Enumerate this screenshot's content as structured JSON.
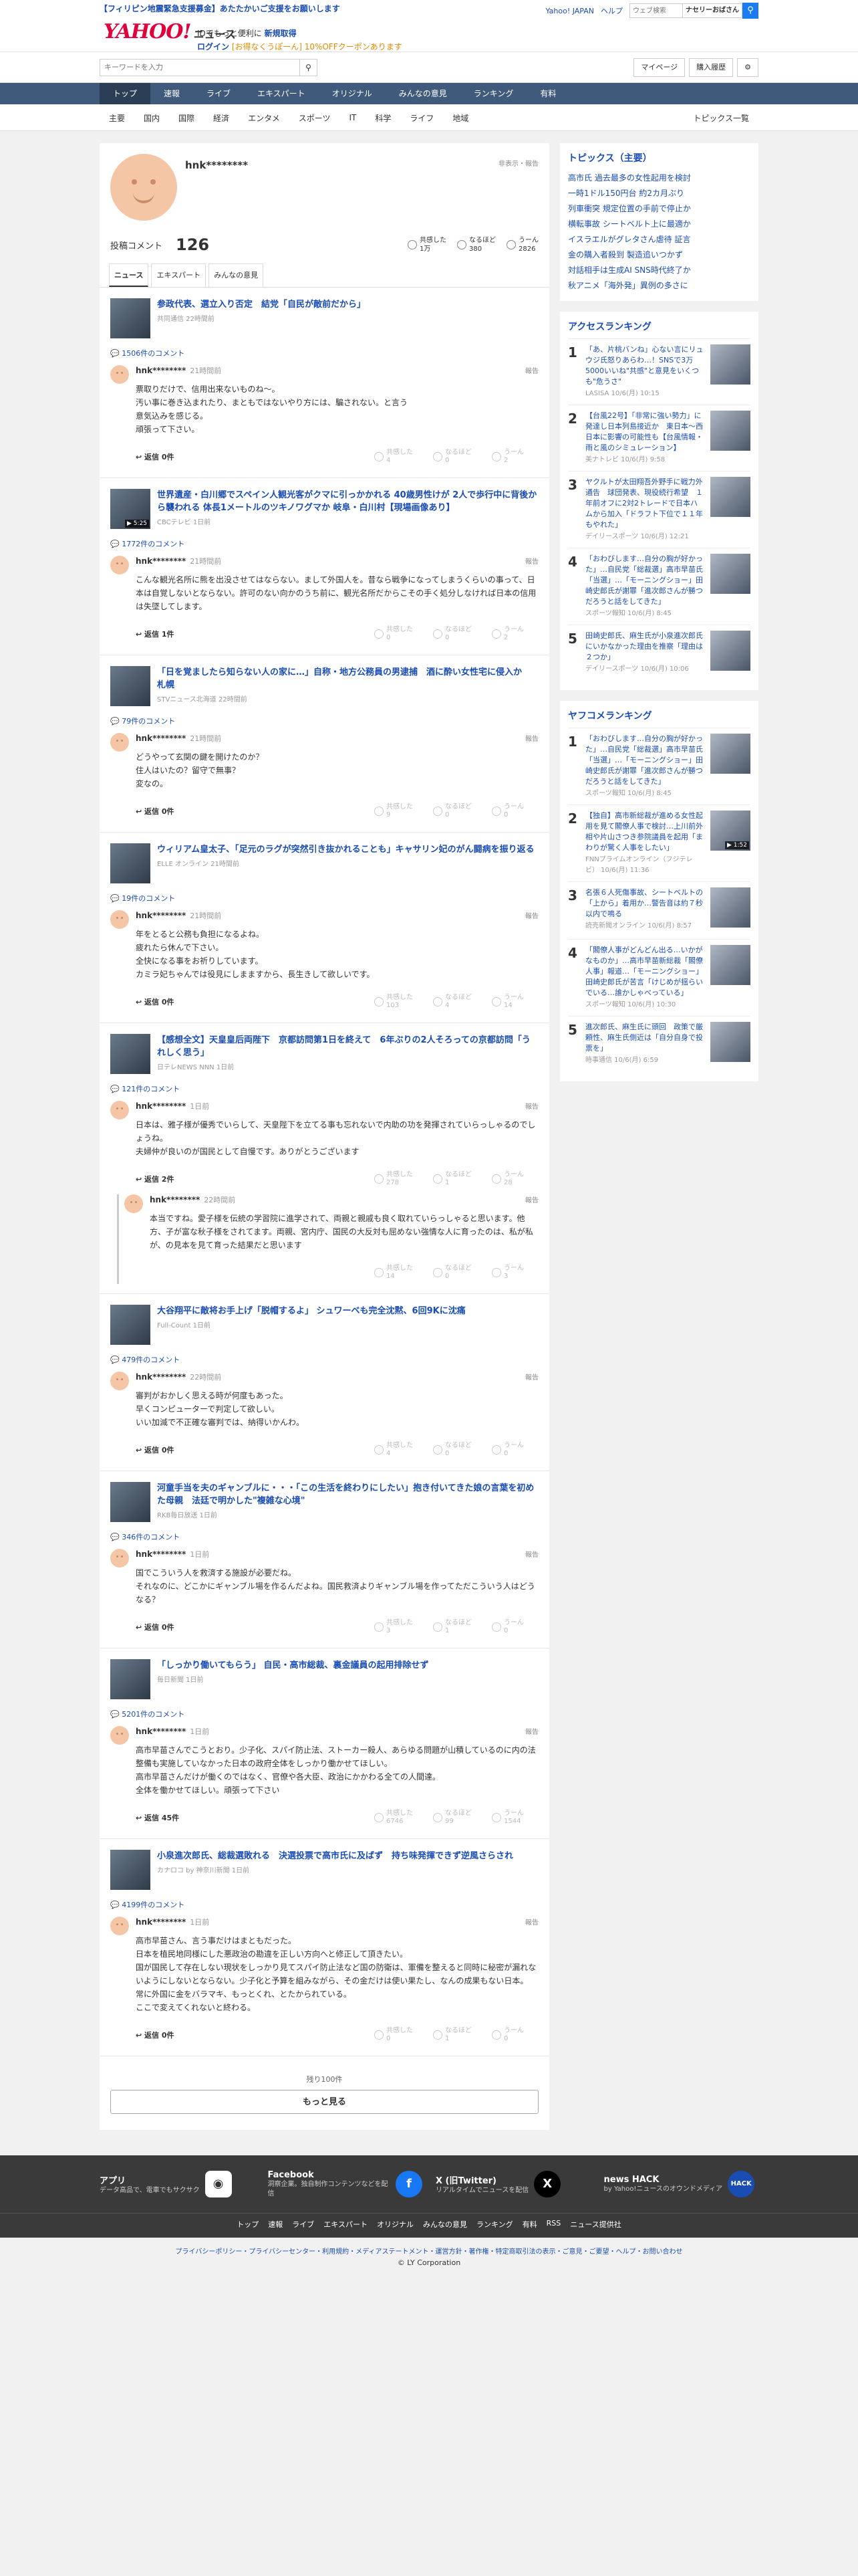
{
  "header": {
    "alert": "【フィリピン地震緊急支援募金】あたたかいご支援をお願いします",
    "links": [
      "Yahoo! JAPAN",
      "ヘルプ"
    ],
    "search_placeholder": "ウェブ検索",
    "user": "ナセリーおばさん",
    "logo_main": "YAHOO!",
    "logo_sub": "JAPAN",
    "logo_news": "ニュース",
    "promo1": "IDでもっと便利に",
    "promo1_link": "新規取得",
    "promo2": "ログイン",
    "promo2_link": "[お得なくうぽーん] 10%OFFクーポンあります"
  },
  "subbar": {
    "keyword_placeholder": "キーワードを入力",
    "mypage": "マイページ",
    "history": "購入履歴"
  },
  "gnav": [
    "トップ",
    "速報",
    "ライブ",
    "エキスパート",
    "オリジナル",
    "みんなの意見",
    "ランキング",
    "有料"
  ],
  "cnav": [
    "主要",
    "国内",
    "国際",
    "経済",
    "エンタメ",
    "スポーツ",
    "IT",
    "科学",
    "ライフ",
    "地域"
  ],
  "cnav_list": "トピックス一覧",
  "profile": {
    "name": "hnk********",
    "public": "非表示・報告",
    "comment_label": "投稿コメント",
    "comment_count": "126",
    "reactions": [
      {
        "label": "共感した",
        "value": "1万"
      },
      {
        "label": "なるほど",
        "value": "380"
      },
      {
        "label": "うーん",
        "value": "2826"
      }
    ]
  },
  "tabs": [
    "ニュース",
    "エキスパート",
    "みんなの意見"
  ],
  "items": [
    {
      "title": "参政代表、選立入り否定　結党「自民が敵前だから」",
      "source": "共同通信 22時間前",
      "count": "1506件のコメント",
      "comments": [
        {
          "user": "hnk********",
          "time": "21時間前",
          "text": "票取りだけで、信用出来ないものね～。\n汚い事に巻き込まれたり、まともではないやり方には、騙されない。と言う\n意気込みを感じる。\n頑張って下さい。",
          "reply": "返信 0件",
          "r": [
            "4",
            "0",
            "2"
          ]
        }
      ]
    },
    {
      "title": "世界遺産・白川郷でスペイン人観光客がクマに引っかかれる 40歳男性けが 2人で歩行中に背後から襲われる 体長1メートルのツキノワグマか 岐阜・白川村【現場画像あり】",
      "source": "CBCテレビ 1日前",
      "count": "1772件のコメント",
      "video": "▶ 5:25",
      "comments": [
        {
          "user": "hnk********",
          "time": "21時間前",
          "text": "こんな観光名所に熊を出没させてはならない。まして外国人を。昔なら戦争になってしまうくらいの事って、日本は自覚しないとならない。許可のない向かのうち前に、観光名所だからこその手く処分しなければ日本の信用は失墜してします。",
          "reply": "返信 1件",
          "r": [
            "0",
            "0",
            "2"
          ]
        }
      ]
    },
    {
      "title": "「日を覚ましたら知らない人の家に…」自称・地方公務員の男逮捕　酒に酔い女性宅に侵入か　札幌",
      "source": "STVニュース北海道 22時間前",
      "count": "79件のコメント",
      "comments": [
        {
          "user": "hnk********",
          "time": "21時間前",
          "text": "どうやって玄関の鍵を開けたのか？\n住人はいたの？留守で無事？\n変なの。",
          "reply": "返信 0件",
          "r": [
            "9",
            "0",
            "0"
          ]
        }
      ]
    },
    {
      "title": "ウィリアム皇太子、「足元のラグが突然引き抜かれることも」キャサリン妃のがん闘病を振り返る",
      "source": "ELLE オンライン 21時間前",
      "count": "19件のコメント",
      "comments": [
        {
          "user": "hnk********",
          "time": "21時間前",
          "text": "年をとると公務も負担になるよね。\n疲れたら休んで下さい。\n全快になる事をお祈りしています。\nカミラ妃ちゃんでは役見にしまますから、長生きして欲しいです。",
          "reply": "返信 0件",
          "r": [
            "103",
            "4",
            "14"
          ]
        }
      ]
    },
    {
      "title": "【感想全文】天皇皇后両陛下　京都訪問第1日を終えて　6年ぶりの2人そろっての京都訪問「うれしく思う」",
      "source": "日テレNEWS NNN 1日前",
      "count": "121件のコメント",
      "comments": [
        {
          "user": "hnk********",
          "time": "1日前",
          "text": "日本は、雅子様が優秀でいらして、天皇陛下を立てる事も忘れないで内助の功を発揮されていらっしゃるのでしょうね。\n夫婦仲が良いのが国民として自慢です。ありがとうございます",
          "reply": "返信 2件",
          "r": [
            "278",
            "1",
            "28"
          ]
        },
        {
          "user": "hnk********",
          "time": "22時間前",
          "text": "本当ですね。愛子様を伝統の学習院に進学されて、両親と親戚も良く取れていらっしゃると思います。他方、子が富な秋子様をされてます。両親、宮内庁、国民の大反対も屈めない強情な人に育ったのは、私が私が、の見本を見て育った結果だと思います",
          "reply": "",
          "r": [
            "14",
            "0",
            "3"
          ]
        }
      ]
    },
    {
      "title": "大谷翔平に敵将お手上げ「脱帽するよ」 シュワーベも完全沈黙、6回9Kに沈痛",
      "source": "Full-Count 1日前",
      "count": "479件のコメント",
      "comments": [
        {
          "user": "hnk********",
          "time": "22時間前",
          "text": "審判がおかしく思える時が何度もあった。\n早くコンピューターで判定して欲しい。\nいい加減で不正確な審判では、納得いかんわ。",
          "reply": "返信 0件",
          "r": [
            "4",
            "0",
            "0"
          ]
        }
      ]
    },
    {
      "title": "河童手当を夫のギャンブルに・・・「この生活を終わりにしたい」抱き付いてきた娘の言葉を初めた母親　法廷で明かした\"複雑な心境\"",
      "source": "RKB毎日放送 1日前",
      "count": "346件のコメント",
      "comments": [
        {
          "user": "hnk********",
          "time": "1日前",
          "text": "国でこういう人を救済する施設が必要だね。\nそれなのに、どこかにギャンブル場を作るんだよね。国民救済よりギャンブル場を作ってただこういう人はどうなる？",
          "reply": "返信 0件",
          "r": [
            "3",
            "1",
            "0"
          ]
        }
      ]
    },
    {
      "title": "「しっかり働いてもらう」 自民・高市総裁、裏金議員の起用排除せず",
      "source": "毎日新聞 1日前",
      "count": "5201件のコメント",
      "comments": [
        {
          "user": "hnk********",
          "time": "1日前",
          "text": "高市早苗さんでこうとおり。少子化、スパイ防止法、ストーカー殺人、あらゆる問題が山積しているのに内の法整備も実施していなかった日本の政府全体をしっかり働かせてほしい。\n高市早苗さんだけが働くのではなく、官僚や各大臣、政治にかかわる全ての人間達。\n全体を働かせてほしい。頑張って下さい",
          "reply": "返信 45件",
          "r": [
            "6746",
            "99",
            "1544"
          ]
        }
      ]
    },
    {
      "title": "小泉進次郎氏、総裁選敗れる　決選投票で高市氏に及ばず　持ち味発揮できず逆風さらされ",
      "source": "カナロコ by 神奈川新聞 1日前",
      "count": "4199件のコメント",
      "comments": [
        {
          "user": "hnk********",
          "time": "1日前",
          "text": "高市早苗さん、言う事だけはまともだった。\n日本を植民地同様にした悪政治の勘違を正しい方向へと修正して頂きたい。\n国が国民して存在しない現状をしっかり見てスパイ防止法など国の防衛は、軍備を整えると同時に秘密が漏れないようにしないとならない。少子化と予算を組みながら、その金だけは使い果たし、なんの成果もない日本。\n常に外国に金をバラマキ、もっとくれ、とたかられている。\nここで変えてくれないと終わる。",
          "reply": "返信 0件",
          "r": [
            "0",
            "1",
            "0"
          ]
        }
      ]
    }
  ],
  "more": {
    "remaining": "残り100件",
    "button": "もっと見る"
  },
  "right": {
    "topics_title": "トピックス（主要）",
    "topics": [
      "高市氏 過去最多の女性起用を検討",
      "一時1ドル150円台 約2カ月ぶり",
      "列車衝突 規定位置の手前で停止か",
      "横転事故 シートベルト上に最適か",
      "イスラエルがグレタさん虐待 証言",
      "金の購入者殺到 製造追いつかず",
      "対話相手は生成AI SNS時代終了か",
      "秋アニメ「海外発」異例の多さに"
    ],
    "access_title": "アクセスランキング",
    "access": [
      {
        "t": "「あ、片桃バンね」心ない言にリュウジ氏怒りあらわ…！SNSで3万5000いいね\"共感\"と意見をいくつも\"危うさ\"",
        "s": "LASISA 10/6(月) 10:15"
      },
      {
        "t": "【台風22号】「非常に強い勢力」に発達し日本列島接近か　東日本～西日本に影響の可能性も【台風情報・雨と風のシミュレーション】",
        "s": "美ナトレビ 10/6(月) 9:58"
      },
      {
        "t": "ヤクルトが太田翔吾外野手に戦力外通告　球団発表、現役続行希望　１年前オフに2対2トレードで日本ハムから加入「ドラフト下位で１１年もやれた」",
        "s": "デイリースポーツ 10/6(月) 12:21"
      },
      {
        "t": "「おわびします…自分の胸が好かった」…自民党「総裁選」高市早苗氏「当選」…「モーニングショー」田崎史郎氏が謝罪「進次郎さんが勝つだろうと話をしてきた」",
        "s": "スポーツ報知 10/6(月) 8:45"
      },
      {
        "t": "田崎史郎氏、麻生氏が小泉進次郎氏にいかなかった理由を推察「理由は２つか」",
        "s": "デイリースポーツ 10/6(月) 10:06"
      }
    ],
    "yahoo_title": "ヤフコメランキング",
    "yahoo": [
      {
        "t": "「おわびします…自分の胸が好かった」…自民党「総裁選」高市早苗氏「当選」…「モーニングショー」田崎史郎氏が謝罪「進次郎さんが勝つだろうと話をしてきた」",
        "s": "スポーツ報知 10/6(月) 8:45"
      },
      {
        "t": "【独自】高市新総裁が進める女性起用を見て閣僚人事で検討…上川前外相や片山さつき参院議員を起用「まわりが驚く人事をしたい」",
        "s": "FNNプライムオンライン（フジテレビ） 10/6(月) 11:36",
        "v": "▶ 1:52"
      },
      {
        "t": "名張６人死傷事故、シートベルトの「上から」着用か…警告音は約７秒以内で鳴る",
        "s": "読売新聞オンライン 10/6(月) 8:57"
      },
      {
        "t": "「閣僚人事がどんどん出る…いかがなものか」…高市早苗新総裁「閣僚人事」報道…「モーニングショー」田崎史郎氏が苦言「けじめが揺らいでいる…誰かしゃべっている」",
        "s": "スポーツ報知 10/6(月) 10:30"
      },
      {
        "t": "進次郎氏、麻生氏に頭回　政策で厳頼性、麻生氏側近は「自分自身で投票を」",
        "s": "時事通信 10/6(月) 6:59"
      }
    ]
  },
  "apps": [
    {
      "t": "アプリ",
      "d": "データ高品で、電車でもサクサク"
    },
    {
      "t": "Facebook",
      "d": "洞察企業。独自制作コンテンツなどを配信"
    },
    {
      "t": "X (旧Twitter)",
      "d": "リアルタイムでニュースを配信"
    },
    {
      "t": "news HACK",
      "d": "by Yahoo!ニュースのオウンドメディア"
    }
  ],
  "footnav": [
    "トップ",
    "速報",
    "ライブ",
    "エキスパート",
    "オリジナル",
    "みんなの意見",
    "ランキング",
    "有料",
    "RSS",
    "ニュース提供社"
  ],
  "legal": "プライバシーポリシー・プライバシーセンター・利用規約・メディアステートメント・運営方針・著作権・特定商取引法の表示・ご意見・ご要望・ヘルプ・お問い合わせ",
  "copyright": "© LY Corporation"
}
